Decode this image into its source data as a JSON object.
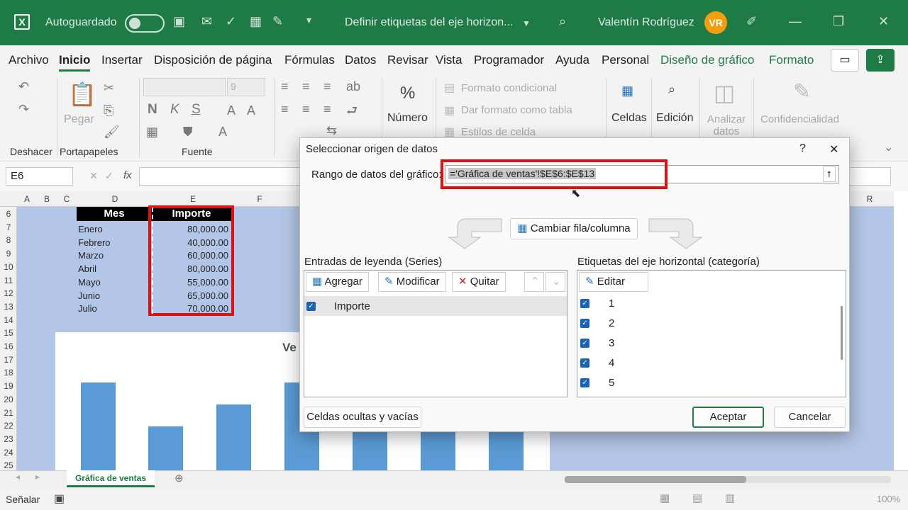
{
  "titlebar": {
    "autosave_label": "Autoguardado",
    "doc_title": "Definir etiquetas del eje horizon...",
    "user_name": "Valentín Rodríguez",
    "user_initials": "VR"
  },
  "tabs": [
    "Archivo",
    "Inicio",
    "Insertar",
    "Disposición de página",
    "Fórmulas",
    "Datos",
    "Revisar",
    "Vista",
    "Programador",
    "Ayuda",
    "Personal",
    "Diseño de gráfico",
    "Formato"
  ],
  "ribbon": {
    "deshacer": "Deshacer",
    "pegar": "Pegar",
    "portapapeles": "Portapapeles",
    "fuente": "Fuente",
    "font_size": "9",
    "bold": "N",
    "italic": "K",
    "underline": "S",
    "numero": "Número",
    "formato_condicional": "Formato condicional",
    "dar_formato": "Dar formato como tabla",
    "estilos": "Estilos de celda",
    "celdas": "Celdas",
    "edicion": "Edición",
    "analizar": "Analizar datos",
    "confidencialidad": "Confidencialidad"
  },
  "formula_bar": {
    "name_box": "E6",
    "fx": "fx"
  },
  "columns": [
    "A",
    "B",
    "C",
    "D",
    "E",
    "F",
    "R"
  ],
  "rows": [
    "6",
    "7",
    "8",
    "9",
    "10",
    "11",
    "12",
    "13",
    "14",
    "15",
    "16",
    "17",
    "18",
    "19",
    "20",
    "21",
    "22",
    "23",
    "24",
    "25"
  ],
  "table": {
    "headers": [
      "Mes",
      "Importe"
    ],
    "rows": [
      [
        "Enero",
        "80,000.00"
      ],
      [
        "Febrero",
        "40,000.00"
      ],
      [
        "Marzo",
        "60,000.00"
      ],
      [
        "Abril",
        "80,000.00"
      ],
      [
        "Mayo",
        "55,000.00"
      ],
      [
        "Junio",
        "65,000.00"
      ],
      [
        "Julio",
        "70,000.00"
      ]
    ]
  },
  "chart": {
    "title_partial": "Ve"
  },
  "sheet_tab": "Gráfica de ventas",
  "status": {
    "mode": "Señalar",
    "zoom": "100%"
  },
  "dialog": {
    "title": "Seleccionar origen de datos",
    "help": "?",
    "close": "✕",
    "range_label": "Rango de datos del gráfico:",
    "range_value": "='Gráfica de ventas'!$E$6:$E$13",
    "switch_button": "Cambiar fila/columna",
    "legend_title": "Entradas de leyenda (Series)",
    "axis_title": "Etiquetas del eje horizontal (categoría)",
    "add": "Agregar",
    "modify": "Modificar",
    "remove": "Quitar",
    "edit": "Editar",
    "series": [
      "Importe"
    ],
    "categories": [
      "1",
      "2",
      "3",
      "4",
      "5"
    ],
    "hidden_cells": "Celdas ocultas y vacías",
    "ok": "Aceptar",
    "cancel": "Cancelar"
  },
  "chart_data": {
    "type": "bar",
    "values": [
      80000,
      40000,
      60000,
      80000,
      55000,
      65000,
      70000
    ],
    "ylim": [
      0,
      100000
    ]
  },
  "colors": {
    "excel_green": "#1e7b45",
    "accent_blue": "#1a64b0",
    "highlight_red": "#e01010",
    "selection": "#b4c6e7"
  }
}
